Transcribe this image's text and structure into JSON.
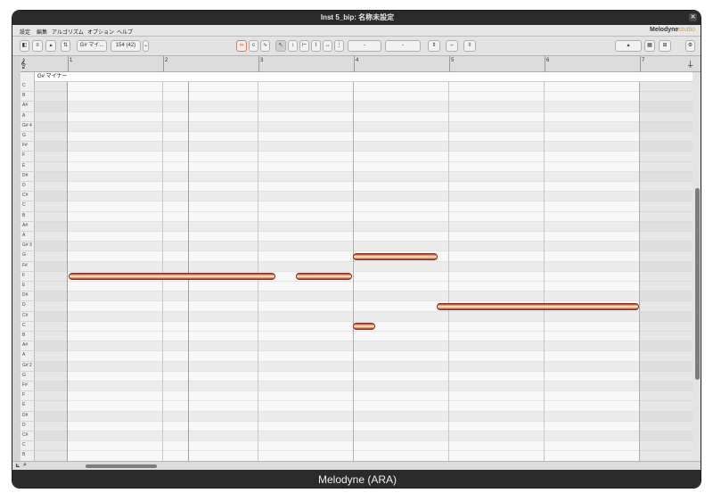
{
  "window": {
    "title": "Inst 5_bip: 名称未設定"
  },
  "menu": {
    "items": [
      "設定",
      "編集",
      "アルゴリズム",
      "オプション",
      "ヘルプ"
    ],
    "brand": "Melodyne",
    "brand_suffix": "studio"
  },
  "toolbar": {
    "scale": "G# マイ...",
    "tempo": "154 (42)"
  },
  "ruler": {
    "bars": [
      "1",
      "2",
      "3",
      "4",
      "5",
      "6",
      "7"
    ]
  },
  "scale_label": "G# マイナー",
  "keys": [
    "C",
    "B",
    "A#",
    "A",
    "G# 4",
    "G",
    "F#",
    "F",
    "E",
    "D#",
    "D",
    "C#",
    "C",
    "B",
    "A#",
    "A",
    "G# 3",
    "G",
    "F#",
    "F",
    "E",
    "D#",
    "D",
    "C#",
    "C",
    "B",
    "A#",
    "A",
    "G# 2",
    "G",
    "F#",
    "F",
    "E",
    "D#",
    "D",
    "C#",
    "C",
    "B",
    "A#"
  ],
  "status": "Melodyne (ARA)"
}
